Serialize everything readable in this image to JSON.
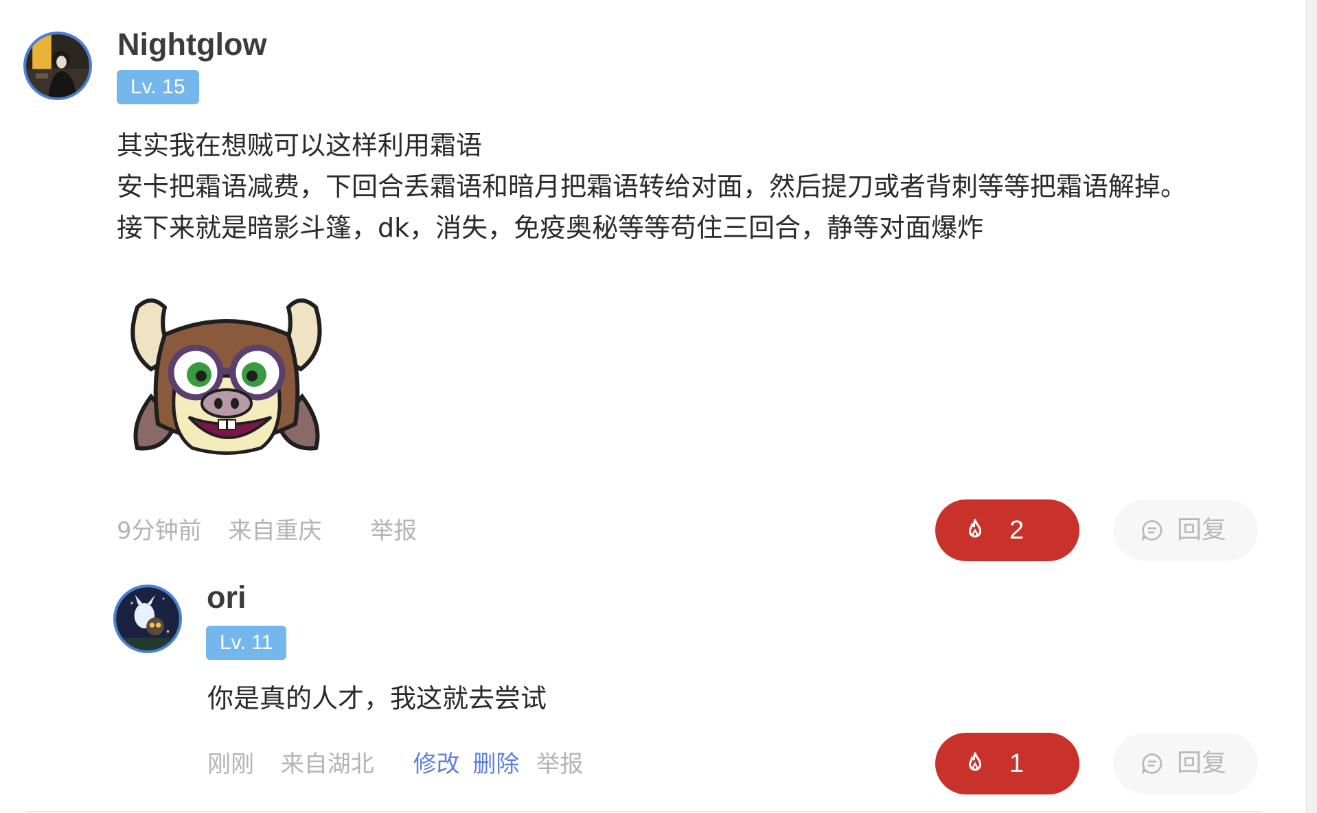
{
  "main_comment": {
    "username": "Nightglow",
    "level": "Lv. 15",
    "text_lines": [
      "其实我在想贼可以这样利用霜语",
      "安卡把霜语减费，下回合丢霜语和暗月把霜语转给对面，然后提刀或者背刺等等把霜语解掉。",
      "接下来就是暗影斗篷，dk，消失，免疫奥秘等等苟住三回合，静等对面爆炸"
    ],
    "sticker_icon": "cow-glasses-emoji",
    "time": "9分钟前",
    "location": "来自重庆",
    "report_label": "举报",
    "like_count": "2",
    "reply_label": "回复"
  },
  "reply_comment": {
    "username": "ori",
    "level": "Lv. 11",
    "text": "你是真的人才，我这就去尝试",
    "time": "刚刚",
    "location": "来自湖北",
    "edit_label": "修改",
    "delete_label": "删除",
    "report_label": "举报",
    "like_count": "1",
    "reply_label": "回复"
  },
  "icons": {
    "like": "flame-icon",
    "reply": "chat-bubble-icon"
  },
  "colors": {
    "like_bg": "#c8322b",
    "level_badge": "#73b7ec",
    "link_blue": "#5b7fdc",
    "avatar_border": "#4a7fd6"
  }
}
